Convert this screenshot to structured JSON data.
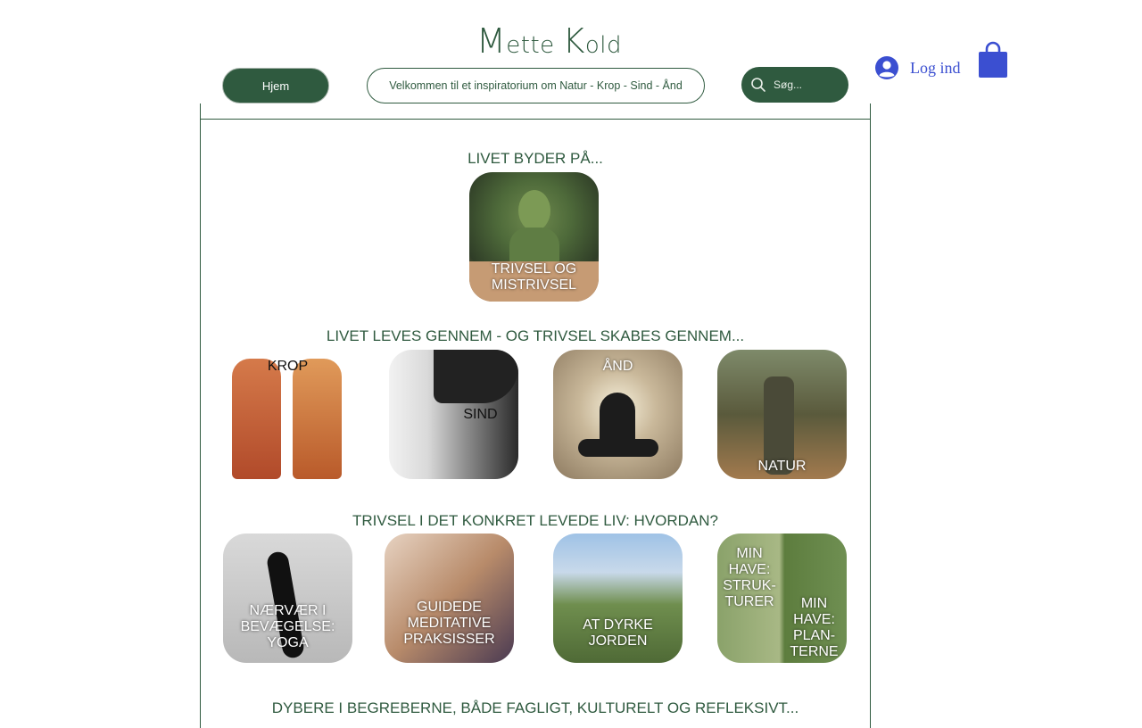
{
  "header": {
    "logo_first_initial": "M",
    "logo_first_rest": "ette",
    "logo_last_initial": "K",
    "logo_last_rest": "old",
    "home_button": "Hjem",
    "welcome_text": "Velkommen til et inspiratorium om Natur - Krop - Sind - Ånd",
    "search_placeholder": "Søg...",
    "login_label": "Log ind"
  },
  "sections": {
    "heading1": "LIVET BYDER PÅ...",
    "heading2": "LIVET LEVES GENNEM - OG TRIVSEL SKABES GENNEM...",
    "heading3": "TRIVSEL I DET KONKRET LEVEDE LIV: HVORDAN?",
    "heading4": "DYBERE I BEGREBERNE, BÅDE FAGLIGT, KULTURELT OG REFLEKSIVT..."
  },
  "tiles": {
    "trivsel": "TRIVSEL OG MISTRIVSEL",
    "krop": "KROP",
    "sind": "SIND",
    "aand": "ÅND",
    "natur": "NATUR",
    "yoga": "NÆRVÆR I BEVÆGELSE: YOGA",
    "meditation": "GUIDEDE MEDITATIVE PRAKSISSER",
    "jorden": "AT DYRKE JORDEN",
    "strukturer": "MIN HAVE: STRUK-TURER",
    "planter": "MIN HAVE: PLAN-TERNE"
  },
  "colors": {
    "brand_green": "#2f5a3f",
    "login_blue": "#3b4fd1"
  }
}
